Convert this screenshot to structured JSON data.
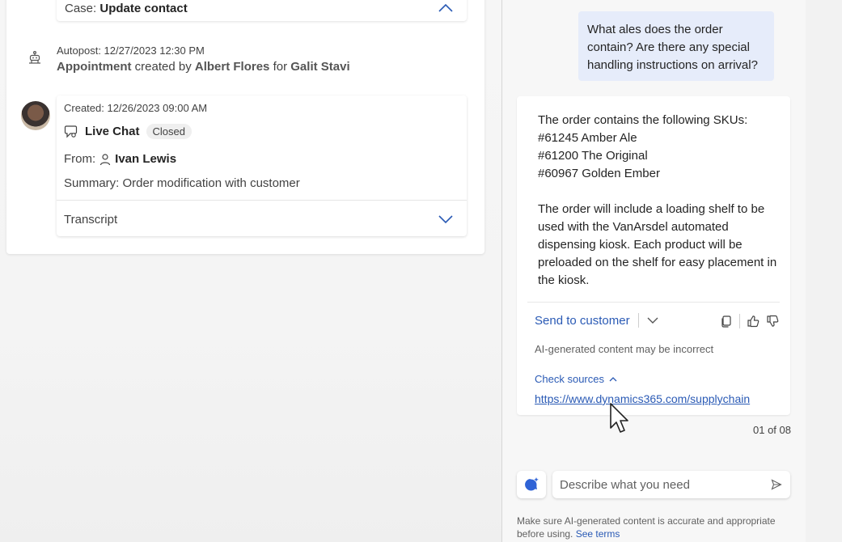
{
  "timeline": {
    "case_prefix": "Case:",
    "case_title": "Update contact",
    "autopost_meta": "Autopost: 12/27/2023 12:30 PM",
    "autopost_entity": "Appointment",
    "autopost_created_by_label": "created by",
    "autopost_creator": "Albert Flores",
    "autopost_for_label": "for",
    "autopost_target": "Galit Stavi",
    "chat_created": "Created: 12/26/2023 09:00 AM",
    "chat_title": "Live Chat",
    "chat_status": "Closed",
    "from_label": "From:",
    "from_name": "Ivan Lewis",
    "summary": "Summary: Order modification with customer",
    "transcript_label": "Transcript"
  },
  "copilot": {
    "user_question": "What ales does the order contain? Are there any special handling instructions on arrival?",
    "answer_intro": "The order contains the following SKUs:",
    "answer_skus": [
      "#61245 Amber Ale",
      "#61200 The Original",
      "#60967 Golden Ember"
    ],
    "answer_handling": "The order will include a loading shelf to be used with the VanArsdel automated dispensing kiosk. Each product will be preloaded on the shelf for easy placement in the kiosk.",
    "send_to_customer": "Send to customer",
    "disclaimer": "AI-generated content may be incorrect",
    "check_sources": "Check sources",
    "source_url": "https://www.dynamics365.com/supplychain",
    "page_counter": "01 of 08",
    "prompt_placeholder": "Describe what you need",
    "footer_text": "Make sure AI-generated content is accurate and appropriate before using.",
    "footer_link": "See terms"
  },
  "colors": {
    "accent": "#2a5ab5",
    "user_bubble": "#e6ecfa",
    "copilot_icon": "#2f63d6"
  }
}
